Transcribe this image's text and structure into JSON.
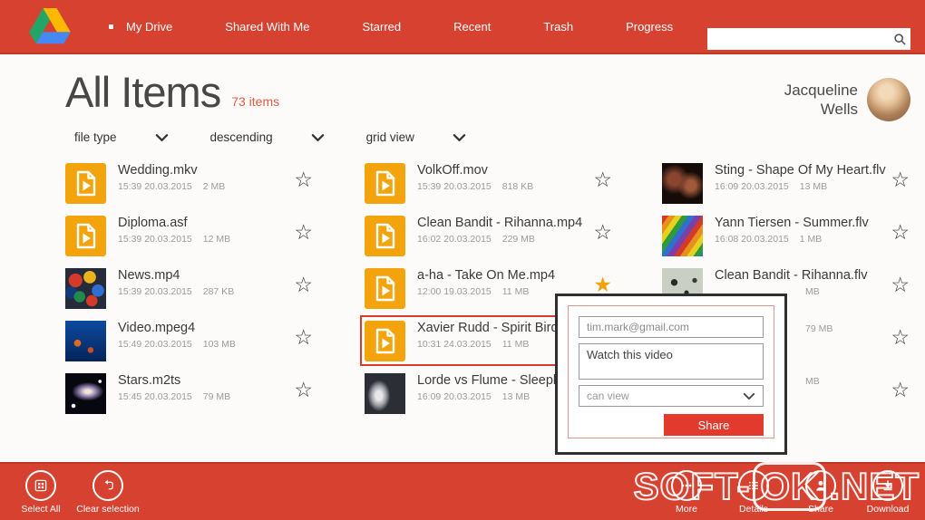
{
  "colors": {
    "accent_red": "#d64130",
    "amber_icon": "#f3a40c",
    "star_gold": "#f0a30a",
    "selection_red": "#d93b2b",
    "share_button_red": "#e23b2e"
  },
  "nav": {
    "items": [
      {
        "label": "My Drive",
        "active": true
      },
      {
        "label": "Shared With Me",
        "active": false
      },
      {
        "label": "Starred",
        "active": false
      },
      {
        "label": "Recent",
        "active": false
      },
      {
        "label": "Trash",
        "active": false
      },
      {
        "label": "Progress",
        "active": false
      }
    ],
    "search_placeholder": ""
  },
  "header": {
    "title": "All Items",
    "count": "73 items",
    "user_name": "Jacqueline Wells"
  },
  "filters": [
    {
      "label": "file type"
    },
    {
      "label": "descending"
    },
    {
      "label": "grid view"
    }
  ],
  "icons": {
    "star_outline": "☆",
    "star_filled": "★"
  },
  "files": {
    "columns": [
      {
        "items": [
          {
            "name": "Wedding.mkv",
            "datetime": "15:39 20.03.2015",
            "size": "2 MB",
            "thumb": "file",
            "starred": false,
            "selected": false
          },
          {
            "name": "Diploma.asf",
            "datetime": "15:39 20.03.2015",
            "size": "12 MB",
            "thumb": "file",
            "starred": false,
            "selected": false
          },
          {
            "name": "News.mp4",
            "datetime": "15:39 20.03.2015",
            "size": "287 KB",
            "thumb": "umbrellas",
            "starred": false,
            "selected": false
          },
          {
            "name": "Video.mpeg4",
            "datetime": "15:49 20.03.2015",
            "size": "103 MB",
            "thumb": "ocean",
            "starred": false,
            "selected": false
          },
          {
            "name": "Stars.m2ts",
            "datetime": "15:45 20.03.2015",
            "size": "79 MB",
            "thumb": "galaxy",
            "starred": false,
            "selected": false
          }
        ]
      },
      {
        "items": [
          {
            "name": "VolkOff.mov",
            "datetime": "15:39 20.03.2015",
            "size": "818 KB",
            "thumb": "file",
            "starred": false,
            "selected": false
          },
          {
            "name": "Clean Bandit - Rihanna.mp4",
            "datetime": "16:02 20.03.2015",
            "size": "229 MB",
            "thumb": "file",
            "starred": false,
            "selected": false
          },
          {
            "name": "a-ha - Take On Me.mp4",
            "datetime": "12:00 19.03.2015",
            "size": "11 MB",
            "thumb": "file",
            "starred": true,
            "selected": false
          },
          {
            "name": "Xavier Rudd - Spirit Bird.",
            "datetime": "10:31 24.03.2015",
            "size": "11 MB",
            "thumb": "file",
            "starred": false,
            "selected": true
          },
          {
            "name": "Lorde vs Flume - Sleeple",
            "datetime": "16:09 20.03.2015",
            "size": "13 MB",
            "thumb": "lorde",
            "starred": false,
            "selected": false
          }
        ]
      },
      {
        "items": [
          {
            "name": "Sting - Shape Of My Heart.flv",
            "datetime": "16:09 20.03.2015",
            "size": "13 MB",
            "thumb": "sting",
            "starred": false,
            "selected": false
          },
          {
            "name": "Yann Tiersen - Summer.flv",
            "datetime": "16:08 20.03.2015",
            "size": "1 MB",
            "thumb": "rainbow",
            "starred": false,
            "selected": false
          },
          {
            "name": "Clean Bandit - Rihanna.flv",
            "datetime": "",
            "size": "MB",
            "thumb": "speckle",
            "starred": false,
            "selected": false,
            "shift": true
          },
          {
            "name": "",
            "datetime": "",
            "size": "79 MB",
            "thumb": "none",
            "starred": false,
            "selected": false,
            "shift": true
          },
          {
            "name": "",
            "datetime": "",
            "size": "MB",
            "thumb": "none",
            "starred": false,
            "selected": false,
            "shift": true
          }
        ]
      }
    ]
  },
  "share_dialog": {
    "email": "tim.mark@gmail.com",
    "message": "Watch this video",
    "permission": "can view",
    "share_label": "Share"
  },
  "bottom_bar": {
    "left": [
      {
        "label": "Select All",
        "icon": "select-all"
      },
      {
        "label": "Clear selection",
        "icon": "clear-selection"
      }
    ],
    "right": [
      {
        "label": "More",
        "icon": "more"
      },
      {
        "label": "Details",
        "icon": "details"
      },
      {
        "label": "Share",
        "icon": "share"
      },
      {
        "label": "Download",
        "icon": "download"
      }
    ]
  },
  "watermark": {
    "prefix": "SOFT-",
    "boxed": "OK",
    "suffix": ".NET"
  }
}
